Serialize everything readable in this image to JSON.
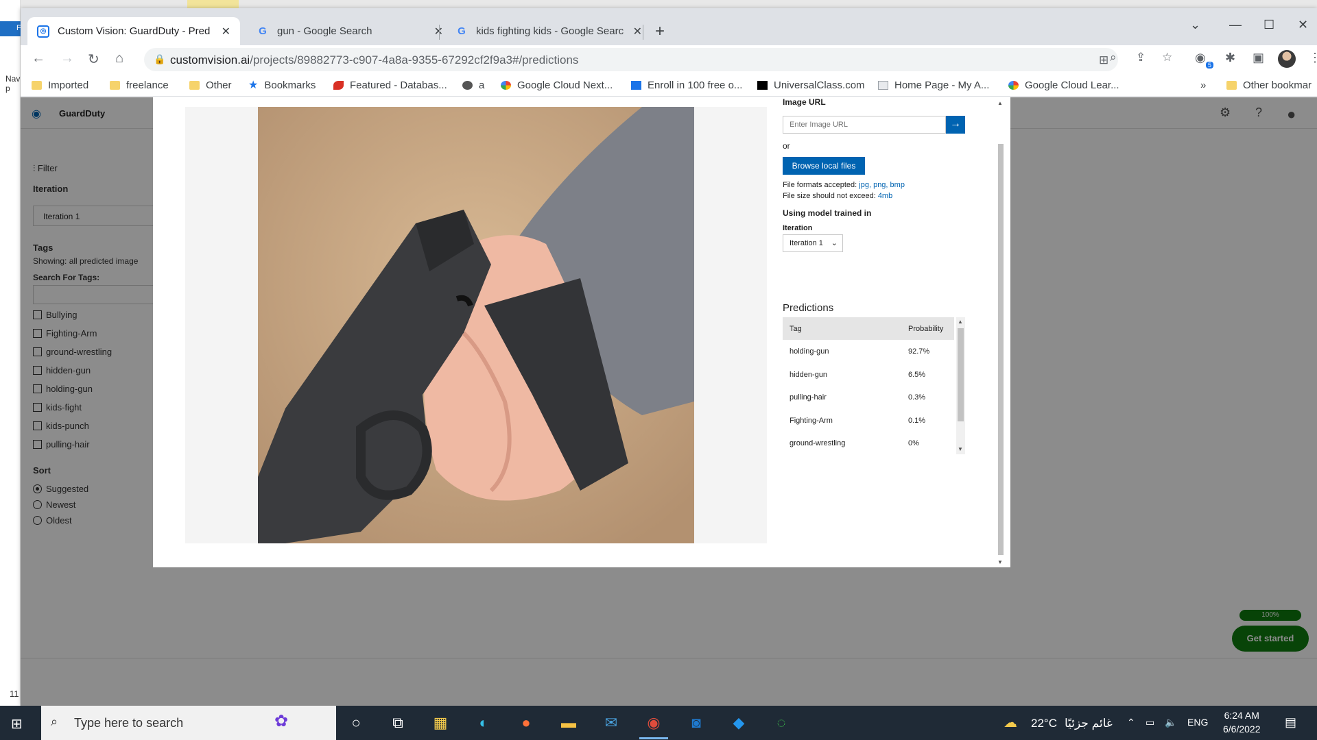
{
  "desktop": {
    "tile_label": "F",
    "nav_label": "Nav",
    "nav_label2": "p",
    "side_number": "11"
  },
  "browser": {
    "tabs": [
      {
        "title": "Custom Vision: GuardDuty - Pred",
        "favicon": "custom-vision-icon",
        "active": true
      },
      {
        "title": "gun - Google Search",
        "favicon": "google-icon",
        "active": false
      },
      {
        "title": "kids fighting kids - Google Searc",
        "favicon": "google-icon",
        "active": false
      }
    ],
    "url_host": "customvision.ai",
    "url_path": "/projects/89882773-c907-4a8a-9355-67292cf2f9a3#/predictions",
    "extension_badge": "5",
    "bookmarks": [
      {
        "label": "Imported",
        "icon": "folder"
      },
      {
        "label": "freelance",
        "icon": "folder"
      },
      {
        "label": "Other",
        "icon": "folder"
      },
      {
        "label": "Bookmarks",
        "icon": "star"
      },
      {
        "label": "Featured - Databas...",
        "icon": "red"
      },
      {
        "label": "a",
        "icon": "bot"
      },
      {
        "label": "Google Cloud Next...",
        "icon": "gc"
      },
      {
        "label": "Enroll in 100 free o...",
        "icon": "blue"
      },
      {
        "label": "UniversalClass.com",
        "icon": "black"
      },
      {
        "label": "Home Page - My A...",
        "icon": "doc"
      },
      {
        "label": "Google Cloud Lear...",
        "icon": "gc"
      }
    ],
    "bookmarks_more": "»",
    "other_bookmarks": "Other bookmar"
  },
  "cv": {
    "project_name": "GuardDuty",
    "sidebar": {
      "filter": "Filter",
      "iteration_label": "Iteration",
      "iteration_value": "Iteration 1",
      "tags_label": "Tags",
      "showing": "Showing: all predicted image",
      "search_tags": "Search For Tags:",
      "tags": [
        "Bullying",
        "Fighting-Arm",
        "ground-wrestling",
        "hidden-gun",
        "holding-gun",
        "kids-fight",
        "kids-punch",
        "pulling-hair"
      ],
      "sort_label": "Sort",
      "sort_options": [
        "Suggested",
        "Newest",
        "Oldest"
      ]
    },
    "progress_pct": "100%",
    "get_started": "Get started"
  },
  "modal": {
    "image_url_label": "Image URL",
    "image_url_placeholder": "Enter Image URL",
    "or": "or",
    "browse_button": "Browse local files",
    "formats_prefix": "File formats accepted: ",
    "formats": "jpg, png, bmp",
    "size_prefix": "File size should not exceed: ",
    "size": "4mb",
    "model_label": "Using model trained in",
    "iteration_label": "Iteration",
    "iteration_value": "Iteration 1",
    "predictions_title": "Predictions",
    "col_tag": "Tag",
    "col_prob": "Probability",
    "predictions": [
      {
        "tag": "holding-gun",
        "prob": "92.7%"
      },
      {
        "tag": "hidden-gun",
        "prob": "6.5%"
      },
      {
        "tag": "pulling-hair",
        "prob": "0.3%"
      },
      {
        "tag": "Fighting-Arm",
        "prob": "0.1%"
      },
      {
        "tag": "ground-wrestling",
        "prob": "0%"
      }
    ]
  },
  "taskbar": {
    "search_placeholder": "Type here to search",
    "weather": "22°C",
    "weather_text": "غائم جزئيًا",
    "lang": "ENG",
    "time": "6:24 AM",
    "date": "6/6/2022"
  }
}
